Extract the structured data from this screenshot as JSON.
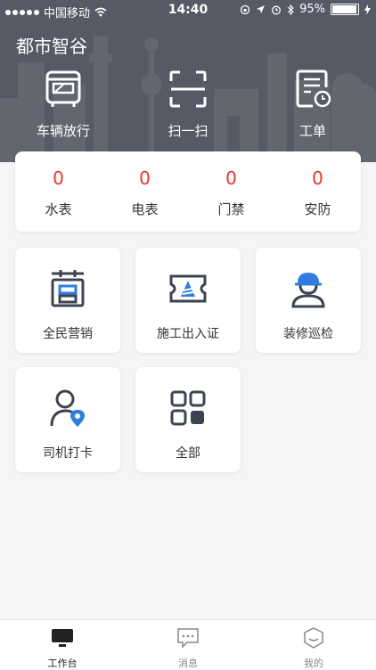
{
  "status_bar": {
    "carrier": "中国移动",
    "time": "14:40",
    "battery": "95%"
  },
  "header": {
    "title": "都市智谷",
    "quick_actions": [
      {
        "label": "车辆放行",
        "icon": "bus-icon"
      },
      {
        "label": "扫一扫",
        "icon": "scan-icon"
      },
      {
        "label": "工单",
        "icon": "work-order-icon"
      }
    ]
  },
  "stats": [
    {
      "value": "0",
      "label": "水表"
    },
    {
      "value": "0",
      "label": "电表"
    },
    {
      "value": "0",
      "label": "门禁"
    },
    {
      "value": "0",
      "label": "安防"
    }
  ],
  "tiles": [
    {
      "label": "全民营销",
      "icon": "marketing-icon"
    },
    {
      "label": "施工出入证",
      "icon": "construction-pass-icon"
    },
    {
      "label": "装修巡检",
      "icon": "inspector-icon"
    },
    {
      "label": "司机打卡",
      "icon": "driver-checkin-icon"
    },
    {
      "label": "全部",
      "icon": "all-apps-icon"
    }
  ],
  "tabbar": [
    {
      "label": "工作台",
      "icon": "monitor-icon",
      "active": true
    },
    {
      "label": "消息",
      "icon": "message-icon",
      "active": false
    },
    {
      "label": "我的",
      "icon": "profile-icon",
      "active": false
    }
  ],
  "colors": {
    "header_bg": "#565a66",
    "value_red": "#e8372f",
    "icon_dark": "#3d4450",
    "icon_blue": "#2f7de1"
  }
}
